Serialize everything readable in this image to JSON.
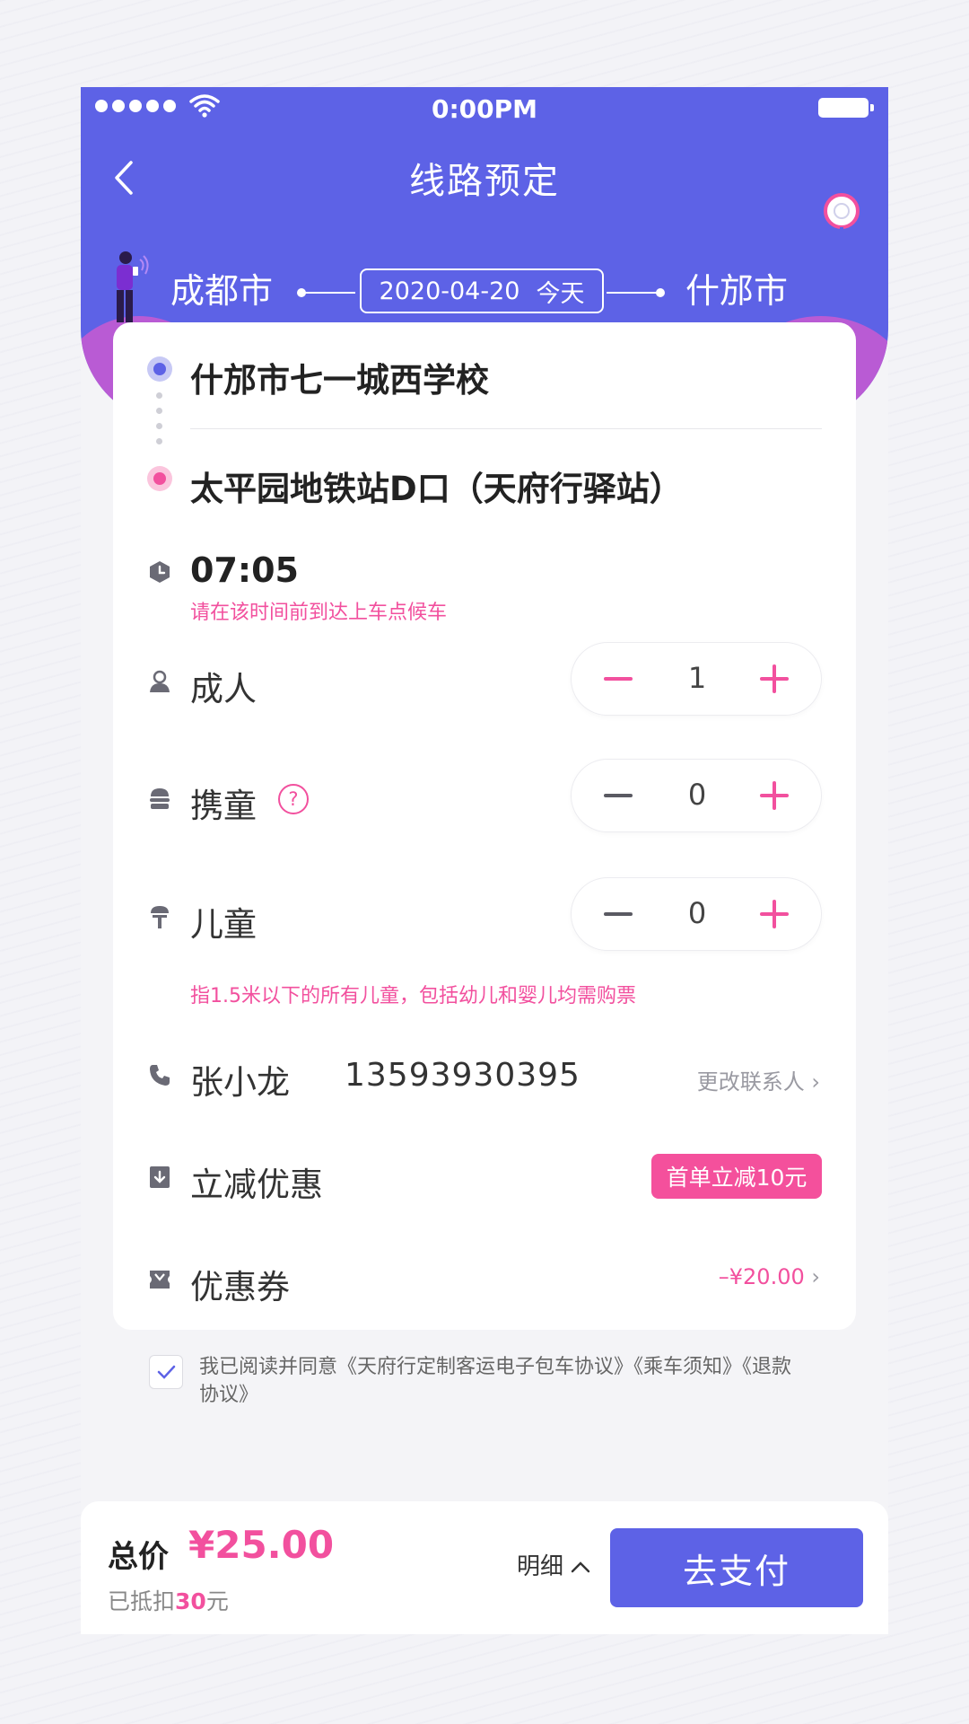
{
  "status_bar": {
    "time": "0:00PM"
  },
  "header": {
    "title": "线路预定"
  },
  "route": {
    "from_city": "成都市",
    "to_city": "什邡市",
    "date": "2020-04-20",
    "date_tag": "今天"
  },
  "trip": {
    "pickup": "什邡市七一城西学校",
    "dropoff": "太平园地铁站D口（天府行驿站）",
    "time": "07:05",
    "time_hint": "请在该时间前到达上车点候车"
  },
  "passengers": {
    "adult": {
      "label": "成人",
      "count": "1"
    },
    "infant": {
      "label": "携童",
      "count": "0",
      "help": "?"
    },
    "child": {
      "label": "儿童",
      "count": "0"
    },
    "child_hint": "指1.5米以下的所有儿童，包括幼儿和婴儿均需购票"
  },
  "contact": {
    "name": "张小龙",
    "phone": "13593930395",
    "change_label": "更改联系人"
  },
  "discount": {
    "label": "立减优惠",
    "tag": "首单立减10元"
  },
  "coupon": {
    "label": "优惠券",
    "value": "–¥20.00"
  },
  "agreement": {
    "text": "我已阅读并同意《天府行定制客运电子包车协议》《乘车须知》《退款协议》"
  },
  "footer": {
    "total_label": "总价",
    "total_value": "¥25.00",
    "deduct_prefix": "已抵扣",
    "deduct_amount": "30",
    "deduct_suffix": "元",
    "detail_label": "明细",
    "pay_label": "去支付"
  },
  "colors": {
    "primary": "#5d62e6",
    "accent": "#f2509e",
    "background": "#f4f4f7"
  },
  "icons": [
    "back-arrow-icon",
    "wifi-icon",
    "clock-icon",
    "adult-icon",
    "infant-icon",
    "child-icon",
    "phone-icon",
    "discount-icon",
    "coupon-icon",
    "check-icon",
    "chevron-right-icon",
    "chevron-up-icon",
    "location-pin-icon"
  ]
}
